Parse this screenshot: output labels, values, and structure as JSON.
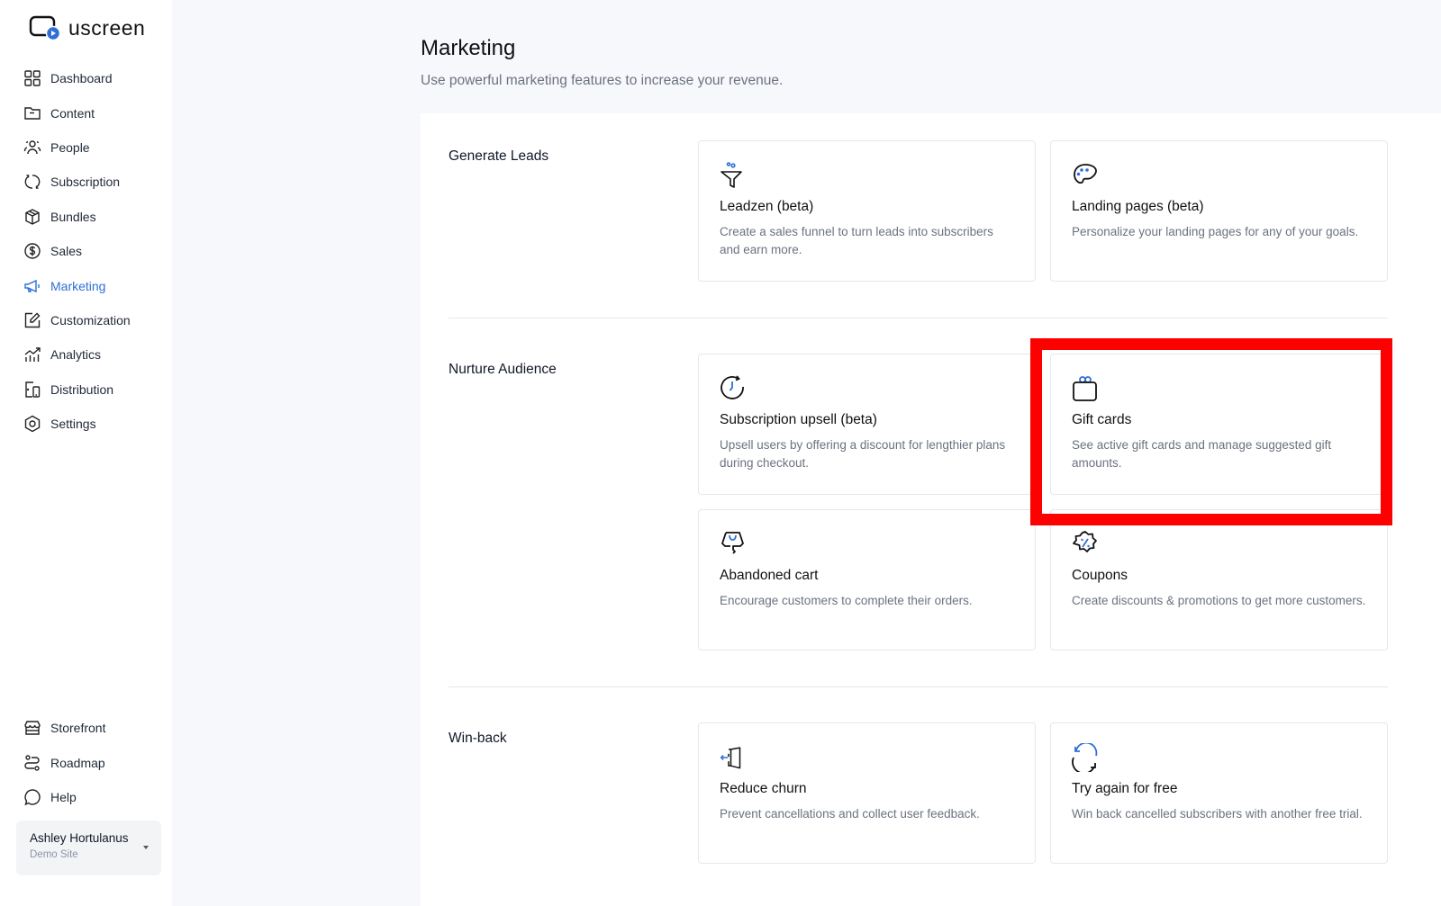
{
  "brand": {
    "name": "uscreen",
    "accent": "#2f6fd6"
  },
  "sidebar": {
    "items": [
      {
        "label": "Dashboard",
        "icon": "dashboard-grid-icon"
      },
      {
        "label": "Content",
        "icon": "folder-icon"
      },
      {
        "label": "People",
        "icon": "people-icon"
      },
      {
        "label": "Subscription",
        "icon": "subscription-cycle-icon"
      },
      {
        "label": "Bundles",
        "icon": "box-icon"
      },
      {
        "label": "Sales",
        "icon": "dollar-circle-icon"
      },
      {
        "label": "Marketing",
        "icon": "megaphone-icon",
        "active": true
      },
      {
        "label": "Customization",
        "icon": "edit-square-icon"
      },
      {
        "label": "Analytics",
        "icon": "analytics-chart-icon"
      },
      {
        "label": "Distribution",
        "icon": "devices-icon"
      },
      {
        "label": "Settings",
        "icon": "settings-hexagon-icon"
      }
    ],
    "bottom_items": [
      {
        "label": "Storefront",
        "icon": "storefront-icon"
      },
      {
        "label": "Roadmap",
        "icon": "roadmap-icon"
      },
      {
        "label": "Help",
        "icon": "chat-bubble-icon"
      }
    ],
    "account": {
      "name": "Ashley Hortulanus",
      "site": "Demo Site"
    }
  },
  "page": {
    "title": "Marketing",
    "subtitle": "Use powerful marketing features to increase your revenue."
  },
  "sections": [
    {
      "label": "Generate Leads",
      "cards": [
        {
          "title": "Leadzen (beta)",
          "description": "Create a sales funnel to turn leads into subscribers and earn more.",
          "icon": "funnel-icon"
        },
        {
          "title": "Landing pages (beta)",
          "description": "Personalize your landing pages for any of your goals.",
          "icon": "palette-icon"
        }
      ]
    },
    {
      "label": "Nurture Audience",
      "cards": [
        {
          "title": "Subscription upsell (beta)",
          "description": "Upsell users by offering a discount for lengthier plans during checkout.",
          "icon": "clock-refresh-icon"
        },
        {
          "title": "Gift cards",
          "description": "See active gift cards and manage suggested gift amounts.",
          "icon": "gift-icon",
          "highlighted": true
        },
        {
          "title": "Abandoned cart",
          "description": "Encourage customers to complete their orders.",
          "icon": "shopping-bag-icon"
        },
        {
          "title": "Coupons",
          "description": "Create discounts & promotions to get more customers.",
          "icon": "percent-badge-icon"
        }
      ]
    },
    {
      "label": "Win-back",
      "cards": [
        {
          "title": "Reduce churn",
          "description": "Prevent cancellations and collect user feedback.",
          "icon": "exit-door-icon"
        },
        {
          "title": "Try again for free",
          "description": "Win back cancelled subscribers with another free trial.",
          "icon": "retry-arrows-icon"
        }
      ]
    }
  ],
  "highlight_color": "#ff0000"
}
